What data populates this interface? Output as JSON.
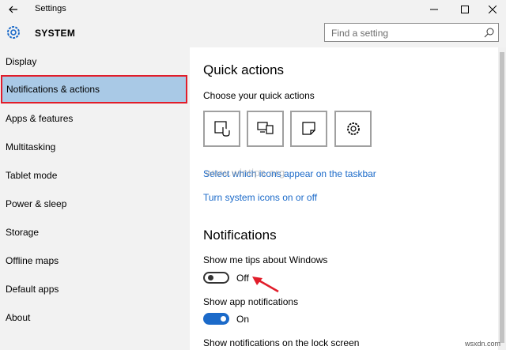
{
  "window": {
    "title": "Settings",
    "minimize_icon": "minimize-icon",
    "maximize_icon": "maximize-icon",
    "close_icon": "close-icon"
  },
  "header": {
    "section": "SYSTEM",
    "search_placeholder": "Find a setting"
  },
  "sidebar": {
    "items": [
      {
        "label": "Display"
      },
      {
        "label": "Notifications & actions"
      },
      {
        "label": "Apps & features"
      },
      {
        "label": "Multitasking"
      },
      {
        "label": "Tablet mode"
      },
      {
        "label": "Power & sleep"
      },
      {
        "label": "Storage"
      },
      {
        "label": "Offline maps"
      },
      {
        "label": "Default apps"
      },
      {
        "label": "About"
      }
    ]
  },
  "main": {
    "quick_actions": {
      "heading": "Quick actions",
      "subheading": "Choose your quick actions",
      "tiles": [
        "tablet-mode-icon",
        "project-icon",
        "note-icon",
        "settings-icon"
      ],
      "link1": "Select which icons appear on the taskbar",
      "link2": "Turn system icons on or off"
    },
    "notifications": {
      "heading": "Notifications",
      "tips_label": "Show me tips about Windows",
      "tips_state": "Off",
      "app_label": "Show app notifications",
      "app_state": "On",
      "lock_label": "Show notifications on the lock screen"
    },
    "watermark": "www.wintips.org"
  },
  "footer": {
    "site": "wsxdn.com"
  },
  "colors": {
    "accent": "#1b6ac9",
    "highlight_border": "#e11d2a",
    "selected_bg": "#a9c9e6"
  }
}
